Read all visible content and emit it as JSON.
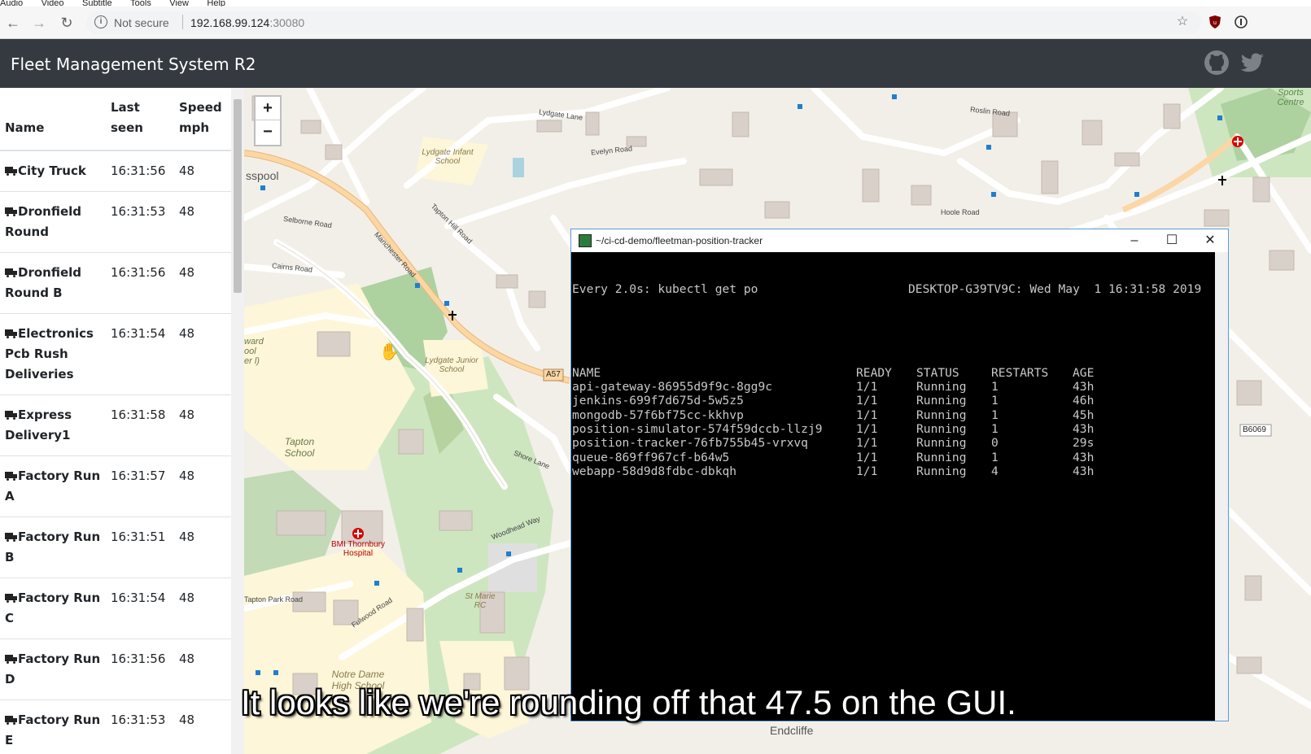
{
  "menubar": {
    "items": [
      "Audio",
      "Video",
      "Subtitle",
      "Tools",
      "View",
      "Help"
    ]
  },
  "browser": {
    "security_label": "Not secure",
    "url_host": "192.168.99.124",
    "url_port": ":30080",
    "icons": [
      "back-arrow-icon",
      "forward-arrow-icon",
      "reload-icon",
      "star-icon",
      "shield-icon",
      "info-icon"
    ]
  },
  "app": {
    "title": "Fleet Management System R2",
    "icons": [
      "github-icon",
      "twitter-icon"
    ]
  },
  "table": {
    "headers": {
      "name": "Name",
      "last_seen": "Last seen",
      "speed": "Speed mph"
    },
    "rows": [
      {
        "name": "City Truck",
        "last_seen": "16:31:56",
        "speed": "48"
      },
      {
        "name": "Dronfield Round",
        "last_seen": "16:31:53",
        "speed": "48"
      },
      {
        "name": "Dronfield Round B",
        "last_seen": "16:31:56",
        "speed": "48"
      },
      {
        "name": "Electronics Pcb Rush Deliveries",
        "last_seen": "16:31:54",
        "speed": "48"
      },
      {
        "name": "Express Delivery1",
        "last_seen": "16:31:58",
        "speed": "48"
      },
      {
        "name": "Factory Run A",
        "last_seen": "16:31:57",
        "speed": "48"
      },
      {
        "name": "Factory Run B",
        "last_seen": "16:31:51",
        "speed": "48"
      },
      {
        "name": "Factory Run C",
        "last_seen": "16:31:54",
        "speed": "48"
      },
      {
        "name": "Factory Run D",
        "last_seen": "16:31:56",
        "speed": "48"
      },
      {
        "name": "Factory Run E",
        "last_seen": "16:31:53",
        "speed": "48"
      }
    ]
  },
  "map": {
    "zoom_in": "+",
    "zoom_out": "−",
    "labels": {
      "lydgate_infant": "Lydgate Infant School",
      "lydgate_junior": "Lydgate Junior School",
      "tapton_school": "Tapton School",
      "bmi": "BMI Thornbury Hospital",
      "notre_dame": "Notre Dame High School",
      "st_marie": "St Marie RC",
      "manchester_road": "Manchester Road",
      "tapton_hill": "Tapton Hill Road",
      "selborne": "Selborne Road",
      "cairns": "Cairns Road",
      "lydgate_lane": "Lydgate Lane",
      "evelyn": "Evelyn Road",
      "hoole": "Hoole Road",
      "roslin": "Roslin Road",
      "shore_lane": "Shore Lane",
      "woodhead": "Woodhead Way",
      "fulwood": "Fulwood Road",
      "tapton_park": "Tapton Park Road",
      "a57": "A57",
      "b6069": "B6069",
      "sports": "Sports Centre",
      "endcliffe": "Endcliffe",
      "sspool": "sspool",
      "ward": "ward ool er l)"
    }
  },
  "terminal": {
    "title": "~/ci-cd-demo/fleetman-position-tracker",
    "header_left": "Every 2.0s: kubectl get po",
    "header_right": "DESKTOP-G39TV9C: Wed May  1 16:31:58 2019",
    "columns": [
      "NAME",
      "READY",
      "STATUS",
      "RESTARTS",
      "AGE"
    ],
    "pods": [
      {
        "name": "api-gateway-86955d9f9c-8gg9c",
        "ready": "1/1",
        "status": "Running",
        "restarts": "1",
        "age": "43h"
      },
      {
        "name": "jenkins-699f7d675d-5w5z5",
        "ready": "1/1",
        "status": "Running",
        "restarts": "1",
        "age": "46h"
      },
      {
        "name": "mongodb-57f6bf75cc-kkhvp",
        "ready": "1/1",
        "status": "Running",
        "restarts": "1",
        "age": "45h"
      },
      {
        "name": "position-simulator-574f59dccb-llzj9",
        "ready": "1/1",
        "status": "Running",
        "restarts": "1",
        "age": "43h"
      },
      {
        "name": "position-tracker-76fb755b45-vrxvq",
        "ready": "1/1",
        "status": "Running",
        "restarts": "0",
        "age": "29s"
      },
      {
        "name": "queue-869ff967cf-b64w5",
        "ready": "1/1",
        "status": "Running",
        "restarts": "1",
        "age": "43h"
      },
      {
        "name": "webapp-58d9d8fdbc-dbkqh",
        "ready": "1/1",
        "status": "Running",
        "restarts": "4",
        "age": "43h"
      }
    ]
  },
  "subtitle": "It looks like we're rounding off that 47.5 on the GUI."
}
